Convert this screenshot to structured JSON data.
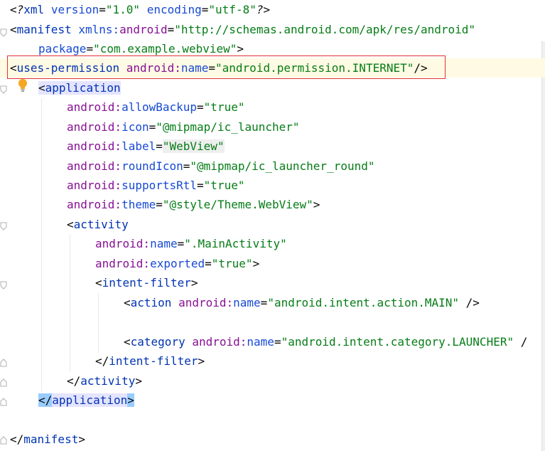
{
  "code": {
    "l1": {
      "open": "<?",
      "xml": "xml",
      "sp1": " ",
      "a1": "version",
      "eq1": "=",
      "v1": "\"1.0\"",
      "sp2": " ",
      "a2": "encoding",
      "eq2": "=",
      "v2": "\"utf-8\"",
      "close": "?>"
    },
    "l2": {
      "lt": "<",
      "tag": "manifest",
      "sp": " ",
      "ns1": "xmlns:",
      "ns2": "android",
      "eq": "=",
      "val": "\"http://schemas.android.com/apk/res/android\""
    },
    "l3": {
      "attr": "package",
      "eq": "=",
      "val": "\"com.example.webview\"",
      "gt": ">"
    },
    "l4": {
      "lt": "<",
      "tag": "uses-permission",
      "sp": " ",
      "ns": "android:",
      "attr": "name",
      "eq": "=",
      "val": "\"android.permission.INTERNET\"",
      "close": "/>"
    },
    "l5": {
      "lt": "<",
      "tag": "application"
    },
    "l6": {
      "ns": "android:",
      "attr": "allowBackup",
      "eq": "=",
      "val": "\"true\""
    },
    "l7": {
      "ns": "android:",
      "attr": "icon",
      "eq": "=",
      "val": "\"@mipmap/ic_launcher\""
    },
    "l8": {
      "ns": "android:",
      "attr": "label",
      "eq": "=",
      "val": "\"WebView\""
    },
    "l9": {
      "ns": "android:",
      "attr": "roundIcon",
      "eq": "=",
      "val": "\"@mipmap/ic_launcher_round\""
    },
    "l10": {
      "ns": "android:",
      "attr": "supportsRtl",
      "eq": "=",
      "val": "\"true\""
    },
    "l11": {
      "ns": "android:",
      "attr": "theme",
      "eq": "=",
      "val": "\"@style/Theme.WebView\"",
      "gt": ">"
    },
    "l12": {
      "lt": "<",
      "tag": "activity"
    },
    "l13": {
      "ns": "android:",
      "attr": "name",
      "eq": "=",
      "val": "\".MainActivity\""
    },
    "l14": {
      "ns": "android:",
      "attr": "exported",
      "eq": "=",
      "val": "\"true\"",
      "gt": ">"
    },
    "l15": {
      "lt": "<",
      "tag": "intent-filter",
      "gt": ">"
    },
    "l16": {
      "lt": "<",
      "tag": "action",
      "sp": " ",
      "ns": "android:",
      "attr": "name",
      "eq": "=",
      "val": "\"android.intent.action.MAIN\"",
      "close": " />"
    },
    "l18": {
      "lt": "<",
      "tag": "category",
      "sp": " ",
      "ns": "android:",
      "attr": "name",
      "eq": "=",
      "val": "\"android.intent.category.LAUNCHER\"",
      "close": " /"
    },
    "l19": {
      "lt": "</",
      "tag": "intent-filter",
      "gt": ">"
    },
    "l20": {
      "lt": "</",
      "tag": "activity",
      "gt": ">"
    },
    "l21": {
      "lt": "</",
      "tag": "application",
      "gt": ">"
    },
    "l23": {
      "lt": "</",
      "tag": "manifest",
      "gt": ">"
    }
  },
  "colors": {
    "tag": "#0033b3",
    "namespace": "#871094",
    "attribute": "#174ad4",
    "value": "#067d17",
    "highlight_box": "#e13232",
    "caret_line": "#fffae3"
  },
  "icons": [
    "fold-marker-icon",
    "lightbulb-icon"
  ]
}
